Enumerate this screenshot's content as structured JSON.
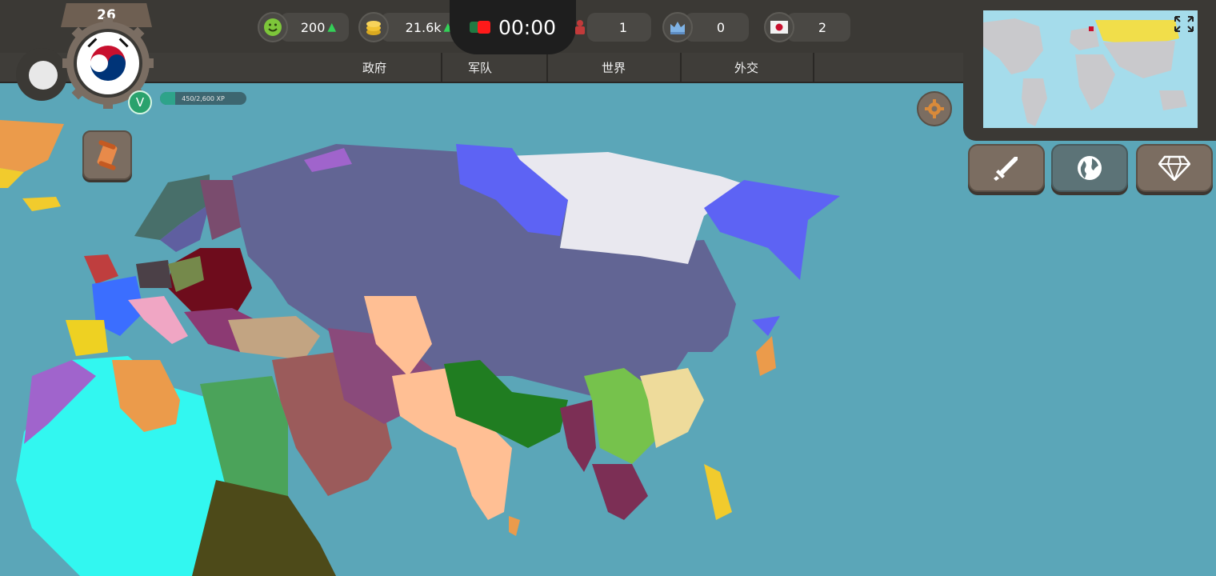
{
  "hud": {
    "level": "26",
    "xp_text": "450/2,600 XP",
    "xp_progress": 0.173,
    "rank_letter": "V",
    "happiness": "200",
    "money": "21.6k",
    "timer": "00:00",
    "stat_military": "1",
    "stat_king": "0",
    "stat_flag": "2"
  },
  "nav": {
    "tabs": [
      "政府",
      "军队",
      "世界",
      "外交"
    ]
  },
  "colors": {
    "ocean": "#5ba6b8",
    "russia": "#626594",
    "siberia_light": "#e9e8ef",
    "blue_regions": "#5d63f4",
    "africa_cyan": "#32f7f0",
    "india_peach": "#ffbf94",
    "green_south_asia": "#207d21"
  },
  "icons": {
    "happiness": "smiley-icon",
    "money": "coins-icon",
    "military": "soldier-icon",
    "king": "crown-icon",
    "flag": "japan-flag-icon",
    "war": "sword-icon",
    "world": "globe-icon",
    "premium": "diamond-icon",
    "fullscreen": "expand-icon",
    "settings": "gear-icon",
    "scroll": "scroll-icon"
  }
}
